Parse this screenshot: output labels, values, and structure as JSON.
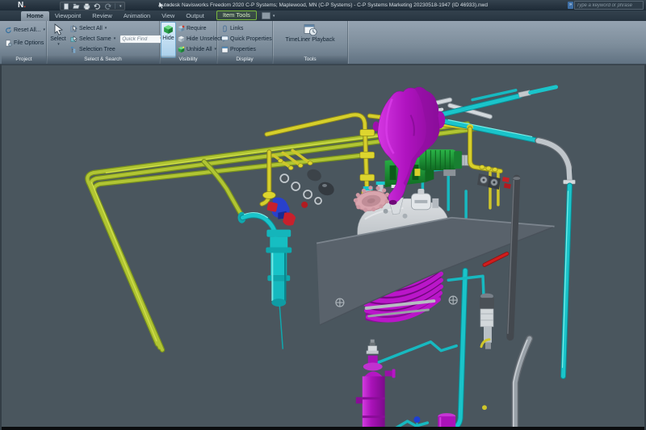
{
  "titlebar": {
    "app_logo": "N",
    "title": "Autodesk Navisworks Freedom 2020   C-P Systems; Maplewood, MN (C-P Systems) - C-P Systems Marketing 20230518-1947 (ID 46933).nwd",
    "search": {
      "placeholder": "Type a keyword or phrase"
    },
    "qat_icons": [
      "new-document",
      "open-folder",
      "print",
      "undo",
      "redo",
      "select-arrow",
      "qat-menu"
    ]
  },
  "tabs": {
    "items": [
      {
        "label": "Home",
        "state": "active"
      },
      {
        "label": "Viewpoint"
      },
      {
        "label": "Review"
      },
      {
        "label": "Animation"
      },
      {
        "label": "View"
      },
      {
        "label": "Output"
      },
      {
        "label": "Item Tools",
        "state": "contextual"
      }
    ]
  },
  "ribbon": {
    "project": {
      "label": "Project",
      "reset_all": "Reset All...",
      "file_options": "File Options"
    },
    "select_search": {
      "label": "Select & Search",
      "select": "Select",
      "select_all": "Select All",
      "select_same": "Select Same",
      "selection_tree": "Selection Tree",
      "quick_find_placeholder": "Quick Find"
    },
    "visibility": {
      "label": "Visibility",
      "hide": "Hide",
      "require": "Require",
      "hide_unselected": "Hide Unselected",
      "unhide_all": "Unhide All"
    },
    "display": {
      "label": "Display",
      "links": "Links",
      "quick_properties": "Quick Properties",
      "properties": "Properties"
    },
    "tools": {
      "label": "Tools",
      "timeliner": "TimeLiner Playback"
    }
  },
  "viewport": {
    "background": "#4a565e"
  },
  "colors": {
    "titlebar_bg": "#27343f",
    "ribbon_bg": "#7e8e9c",
    "contextual_tab_green": "#79b83f",
    "hide_button_highlight": "#a9cfea",
    "pipe_yellow_green": "#b1c533",
    "pipe_bright_yellow": "#d6cf2b",
    "pipe_cyan": "#1ac4ca",
    "hopper_magenta": "#b614c6",
    "coil_magenta": "#ba16c9",
    "motor_green": "#1d9a35",
    "platform_gray": "#59626b",
    "dome_gray": "#c6cbcf",
    "red_accent": "#c41a1a",
    "actuator_blue": "#2941cc",
    "gear_pink": "#d9a5ae"
  }
}
